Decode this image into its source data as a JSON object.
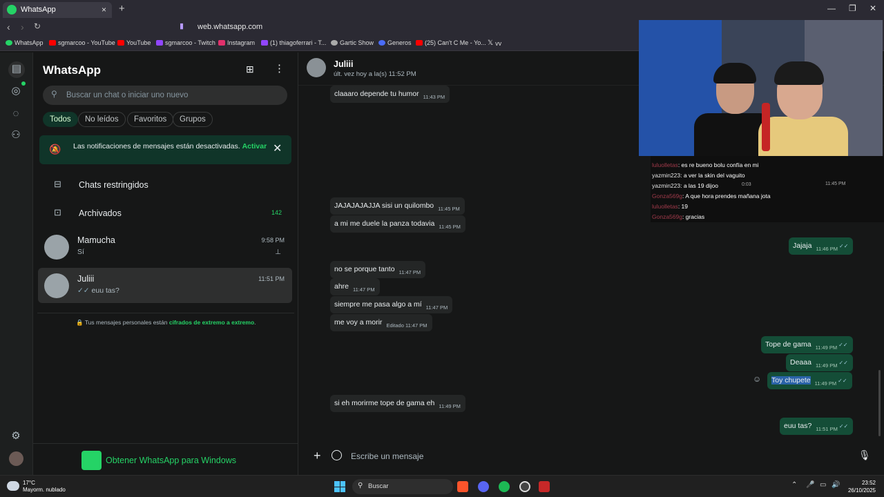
{
  "browser": {
    "tab_title": "WhatsApp",
    "tab_close": "×",
    "new_tab": "+",
    "url": "web.whatsapp.com",
    "bookmarks": [
      "WhatsApp",
      "sgmarcoo - YouTube",
      "YouTube",
      "sgmarcoo - Twitch",
      "Instagram",
      "(1) thiagoferrari - T...",
      "Gartic Show",
      "Generos",
      "(25) Can't C Me - Yo...",
      "vv"
    ]
  },
  "sidebar": {
    "app_title": "WhatsApp",
    "search_placeholder": "Buscar un chat o iniciar uno nuevo",
    "filters": [
      "Todos",
      "No leídos",
      "Favoritos",
      "Grupos"
    ],
    "notification": {
      "text": "Las notificaciones de mensajes están desactivadas.",
      "action": "Activar"
    },
    "restricted": "Chats restringidos",
    "archived": "Archivados",
    "archived_count": "142",
    "chats": [
      {
        "name": "Mamucha",
        "preview": "Sí",
        "time": "9:58 PM"
      },
      {
        "name": "Juliii",
        "preview": "euu tas?",
        "time": "11:51 PM"
      }
    ],
    "encryption_pre": "Tus mensajes personales están ",
    "encryption_link": "cifrados de extremo a extremo",
    "encryption_post": ".",
    "get_app": "Obtener WhatsApp para Windows"
  },
  "chat": {
    "contact": "Juliii",
    "status": "últ. vez hoy a la(s) 11:52 PM",
    "composer_placeholder": "Escribe un mensaje",
    "messages": [
      {
        "text": "claaaro depende tu humor",
        "time": "11:43 PM"
      },
      {
        "text": "JAJAJAJAJJA sisi un quilombo",
        "time": "11:45 PM"
      },
      {
        "text": "a mi me duele la panza todavia",
        "time": "11:45 PM"
      },
      {
        "text": "Jajaja",
        "time": "11:46 PM"
      },
      {
        "text": "no se porque tanto",
        "time": "11:47 PM"
      },
      {
        "text": "ahre",
        "time": "11:47 PM"
      },
      {
        "text": "siempre me pasa algo a mí",
        "time": "11:47 PM"
      },
      {
        "text": "me voy a morir",
        "edited": "Editado",
        "time": "11:47 PM"
      },
      {
        "text": "Tope de gama",
        "time": "11:49 PM"
      },
      {
        "text": "Deaaa",
        "time": "11:49 PM"
      },
      {
        "text": "Toy chupete",
        "time": "11:49 PM"
      },
      {
        "text": "si eh morirme tope de gama eh",
        "time": "11:49 PM"
      },
      {
        "text": "euu tas?",
        "time": "11:51 PM"
      }
    ]
  },
  "stream_chat": [
    {
      "user": "luluolletas",
      "msg": ": es re bueno bolu confía en mi"
    },
    {
      "user": "yazmin223",
      "msg": ": a ver la skin del vaguito"
    },
    {
      "user": "yazmin223",
      "msg": ": a las 19 dijoo"
    },
    {
      "user": "Gonza569g",
      "msg": ": A que hora prendes mañana jota"
    },
    {
      "user": "luluolletas",
      "msg": ": 19"
    },
    {
      "user": "Gonza569g",
      "msg": ": gracias"
    }
  ],
  "overlay_times": {
    "duration": "0:03",
    "time": "11:45 PM"
  },
  "taskbar": {
    "weather_temp": "17°C",
    "weather_desc": "Mayorm. nublado",
    "search": "Buscar",
    "time": "23:52",
    "date": "26/10/2025"
  },
  "colors": {
    "accent": "#25d366",
    "outgoing": "#144d37",
    "incoming": "#242626"
  }
}
